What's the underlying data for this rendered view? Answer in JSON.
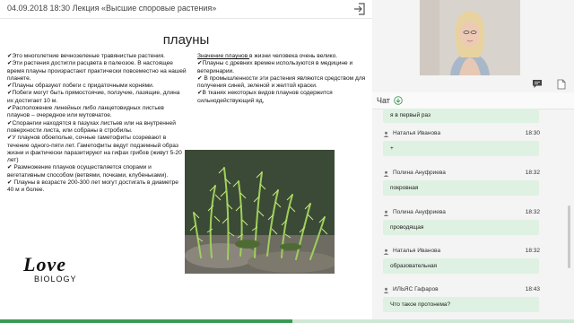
{
  "header": {
    "title": "04.09.2018 18:30 Лекция «Высшие споровые растения»",
    "exit_icon": "exit-icon"
  },
  "slide": {
    "title": "плауны",
    "left_paragraphs": [
      "✔Это многолетние вечнозеленые травянистые растения.",
      "✔Эти растения достигли расцвета в палеозое. В настоящее время плауны произрастают практически повсеместно на нашей планете.",
      "✔Плауны образуют побеги с придаточными корнями.",
      "✔Побеги могут быть прямостоячие, ползучие, лазящие, длина их достигает 10 м.",
      "✔Расположение линейных либо ланцетовидных листьев плаунов – очередное или мутовчатое.",
      "✔Спорангии находятся в пазухах листьев или на внутренней поверхности листа, или собраны в стробилы.",
      "✔У плаунов обоеполые, сочные гаметофиты созревают в течение одного-пяти лет. Гаметофиты  ведут подземный образ жизни и фактически паразитируют на  гифах грибов (живут  5-20 лет)",
      "✔ Размножение плаунов осуществляется спорами и вегетативным способом (ветвями, почками, клубеньками).",
      "✔ Плауны в возрасте 200-300 лет могут достигать в диаметре 40 м и более."
    ],
    "right_lead_underlined": "Значение плаунов ",
    "right_lead_rest": "в жизни человека очень велико.",
    "right_paragraphs": [
      "✔Плауны с древних времен используются в медицине и ветеринарии.",
      "✔ В промышленности эти растения являются средством для получения синей, зеленой и желтой краски.",
      "✔В тканях некоторых видов плаунов содержится сильнодействующий яд,"
    ],
    "logo_word1": "Love",
    "logo_word2": "BIOLOGY"
  },
  "playback": {
    "progress": 0.51
  },
  "chat": {
    "title": "Чат",
    "messages": [
      {
        "name": "",
        "time": "",
        "text": "я в первый раз"
      },
      {
        "name": "Наталья Иванова",
        "time": "18:30",
        "text": "+"
      },
      {
        "name": "Полина Ануфриева",
        "time": "18:32",
        "text": "покровная"
      },
      {
        "name": "Полина Ануфриева",
        "time": "18:32",
        "text": "проводящая"
      },
      {
        "name": "Наталья Иванова",
        "time": "18:32",
        "text": "образовательная"
      },
      {
        "name": "ИЛЬЯС Гафаров",
        "time": "18:43",
        "text": "Что такое протонема?"
      }
    ]
  },
  "colors": {
    "accent_green": "#3a9a55",
    "bubble_green": "#dff1e2"
  }
}
